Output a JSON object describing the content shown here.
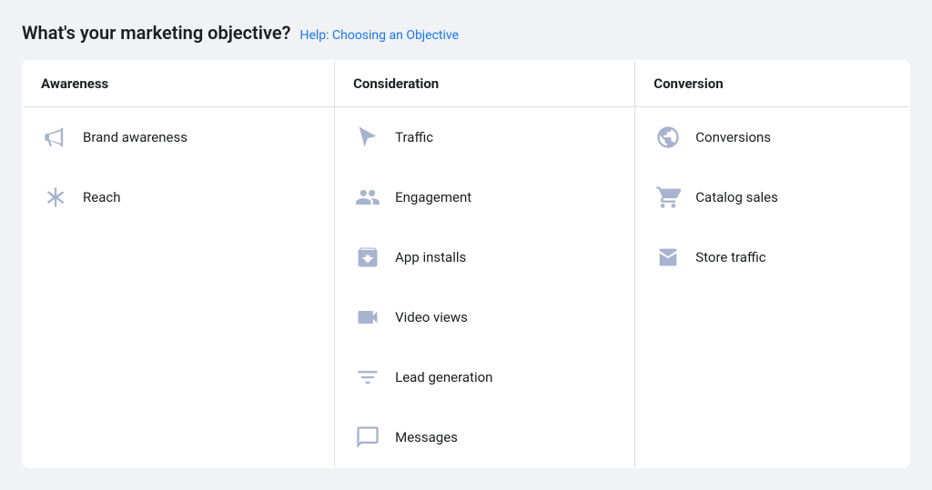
{
  "header": {
    "title": "What's your marketing objective?",
    "help_link_label": "Help: Choosing an Objective"
  },
  "columns": [
    {
      "id": "awareness",
      "header": "Awareness",
      "items": [
        {
          "id": "brand-awareness",
          "label": "Brand awareness",
          "icon": "megaphone"
        },
        {
          "id": "reach",
          "label": "Reach",
          "icon": "asterisk"
        }
      ]
    },
    {
      "id": "consideration",
      "header": "Consideration",
      "items": [
        {
          "id": "traffic",
          "label": "Traffic",
          "icon": "cursor"
        },
        {
          "id": "engagement",
          "label": "Engagement",
          "icon": "people"
        },
        {
          "id": "app-installs",
          "label": "App installs",
          "icon": "box"
        },
        {
          "id": "video-views",
          "label": "Video views",
          "icon": "video"
        },
        {
          "id": "lead-generation",
          "label": "Lead generation",
          "icon": "filter"
        },
        {
          "id": "messages",
          "label": "Messages",
          "icon": "chat"
        }
      ]
    },
    {
      "id": "conversion",
      "header": "Conversion",
      "items": [
        {
          "id": "conversions",
          "label": "Conversions",
          "icon": "globe"
        },
        {
          "id": "catalog-sales",
          "label": "Catalog sales",
          "icon": "cart"
        },
        {
          "id": "store-traffic",
          "label": "Store traffic",
          "icon": "store"
        }
      ]
    }
  ]
}
